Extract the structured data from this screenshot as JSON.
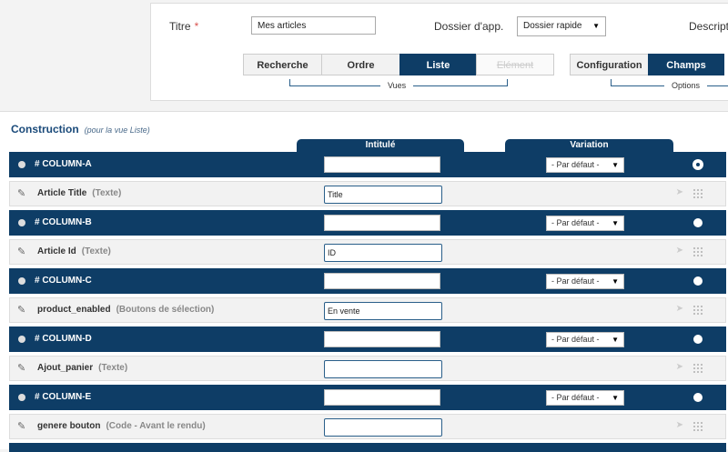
{
  "header": {
    "titre_label": "Titre",
    "required_mark": "*",
    "titre_value": "Mes articles",
    "dossier_label": "Dossier d'app.",
    "dossier_value": "Dossier rapide",
    "descript_label": "Descript"
  },
  "vues": {
    "group_label": "Vues",
    "tabs": [
      {
        "label": "Recherche",
        "state": "normal"
      },
      {
        "label": "Ordre",
        "state": "normal"
      },
      {
        "label": "Liste",
        "state": "active"
      },
      {
        "label": "Elément",
        "state": "disabled"
      }
    ]
  },
  "options": {
    "group_label": "Options",
    "tabs": [
      {
        "label": "Configuration",
        "state": "normal"
      },
      {
        "label": "Champs",
        "state": "active"
      }
    ]
  },
  "construction": {
    "title": "Construction",
    "subtitle": "(pour la vue Liste)",
    "col_intitule": "Intitulé",
    "col_variation": "Variation",
    "default_variation": "- Par défaut -",
    "rows": [
      {
        "kind": "column",
        "name": "# COLUMN-A",
        "selected": true
      },
      {
        "kind": "field",
        "name": "Article Title",
        "type": "(Texte)",
        "value": "Title"
      },
      {
        "kind": "column",
        "name": "# COLUMN-B",
        "selected": false
      },
      {
        "kind": "field",
        "name": "Article Id",
        "type": "(Texte)",
        "value": "ID"
      },
      {
        "kind": "column",
        "name": "# COLUMN-C",
        "selected": false
      },
      {
        "kind": "field",
        "name": "product_enabled",
        "type": "(Boutons de sélection)",
        "value": "En vente"
      },
      {
        "kind": "column",
        "name": "# COLUMN-D",
        "selected": false
      },
      {
        "kind": "field",
        "name": "Ajout_panier",
        "type": "(Texte)",
        "value": ""
      },
      {
        "kind": "column",
        "name": "# COLUMN-E",
        "selected": false
      },
      {
        "kind": "field",
        "name": "genere bouton",
        "type": "(Code - Avant le rendu)",
        "value": ""
      }
    ]
  },
  "icons": {
    "pencil": "pencil-icon",
    "move": "move-arrow-icon",
    "grip": "drag-grip-icon",
    "dropdown": "chevron-down-icon"
  }
}
